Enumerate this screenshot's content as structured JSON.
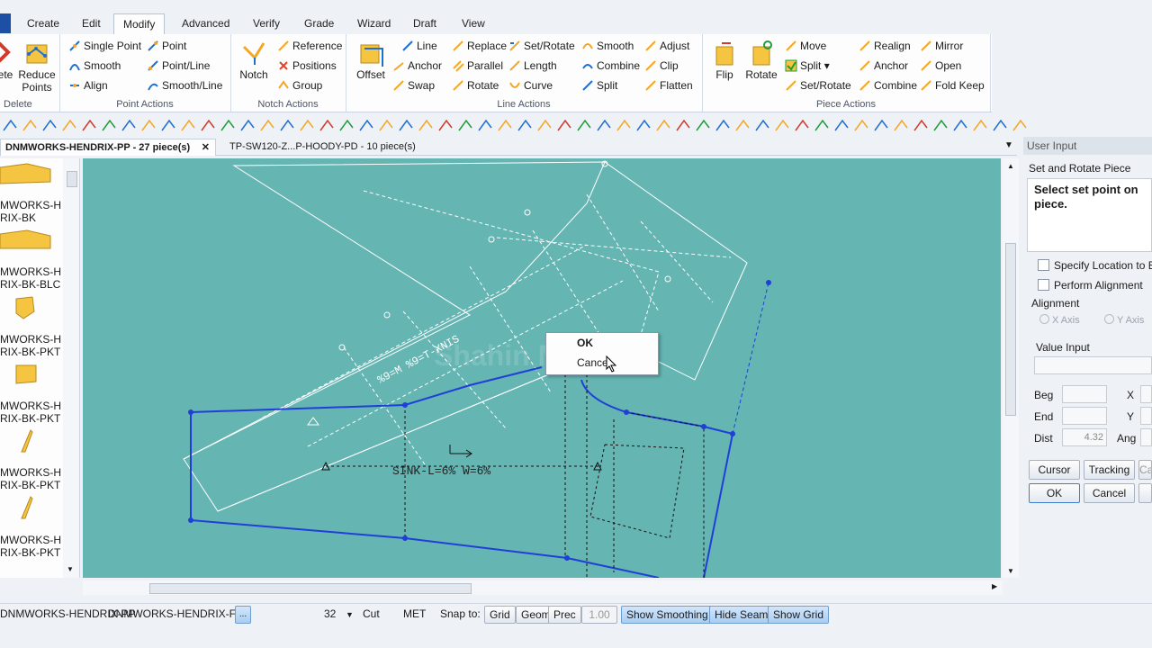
{
  "menu": {
    "tabs": [
      {
        "label": "Create"
      },
      {
        "label": "Edit"
      },
      {
        "label": "Modify"
      },
      {
        "label": "Advanced"
      },
      {
        "label": "Verify"
      },
      {
        "label": "Grade"
      },
      {
        "label": "Wizard"
      },
      {
        "label": "Draft"
      },
      {
        "label": "View"
      }
    ],
    "active": "Modify"
  },
  "ribbon": {
    "delete": {
      "label": "Delete",
      "left_btn": "ete",
      "reduce_points": "Reduce\nPoints"
    },
    "point_actions": {
      "label": "Point Actions",
      "items": [
        "Single Point",
        "Point",
        "Smooth",
        "Point/Line",
        "Align",
        "Smooth/Line"
      ]
    },
    "notch_actions": {
      "label": "Notch Actions",
      "notch": "Notch",
      "items": [
        "Reference",
        "Positions",
        "Group"
      ]
    },
    "line_actions": {
      "label": "Line Actions",
      "offset": "Offset",
      "items": [
        "Line",
        "Replace",
        "Set/Rotate",
        "Smooth",
        "Adjust",
        "Anchor",
        "Parallel",
        "Length",
        "Combine",
        "Clip",
        "Swap",
        "Rotate",
        "Curve",
        "Split",
        "Flatten"
      ]
    },
    "piece_actions": {
      "label": "Piece Actions",
      "flip": "Flip",
      "rotate": "Rotate",
      "items": [
        "Move",
        "Realign",
        "Mirror",
        "Split",
        "Anchor",
        "Open",
        "Set/Rotate",
        "Combine",
        "Fold Keep"
      ]
    }
  },
  "doc_tabs": [
    {
      "label": "DNMWORKS-HENDRIX-PP  -  27 piece(s)",
      "close": "✕"
    },
    {
      "label": "TP-SW120-Z...P-HOODY-PD  -  10 piece(s)"
    }
  ],
  "pieces": [
    "MWORKS-H",
    "RIX-BK",
    "MWORKS-H",
    "RIX-BK-BLC",
    "MWORKS-H",
    "RIX-BK-PKT",
    "MWORKS-H",
    "RIX-BK-PKT",
    "MWORKS-H",
    "RIX-BK-PKT",
    "MWORKS-H",
    "RIX-BK-PKT"
  ],
  "canvas": {
    "annotation": "SINK-L=6% W=6%",
    "rotated_annotation": "%9=M %9=T-XNIS",
    "watermark": "Shahin Mondol"
  },
  "context_menu": {
    "ok": "OK",
    "cancel": "Cancel"
  },
  "user_input": {
    "header": "User Input",
    "title": "Set and Rotate Piece",
    "prompt": "Select set point on piece.",
    "specify_location": "Specify Location to Bump",
    "perform_alignment": "Perform Alignment",
    "alignment": "Alignment",
    "x_axis": "X Axis",
    "y_axis": "Y Axis",
    "value_input": "Value Input",
    "beg": "Beg",
    "end": "End",
    "dist": "Dist",
    "dist_value": "4.32",
    "x": "X",
    "y": "Y",
    "ang": "Ang",
    "cursor": "Cursor",
    "tracking": "Tracking",
    "cut": "Ca",
    "ok": "OK",
    "cancel": "Cancel"
  },
  "status": {
    "doc1": "DNMWORKS-HENDRIX-PP",
    "doc2": "DNMWORKS-HENDRIX-FR",
    "more": "...",
    "zoom": "32",
    "cut": "Cut",
    "units": "MET",
    "snap_to": "Snap to:",
    "grid": "Grid",
    "geom": "Geom",
    "prec": "Prec",
    "prec_value": "1.00",
    "show_smoothing": "Show Smoothing",
    "hide_seams": "Hide Seams",
    "show_grid": "Show Grid"
  },
  "colors": {
    "canvas": "#65b5b3",
    "selected_piece": "#1f3fd6",
    "piece_outline": "#ffffff",
    "menu_blue": "#1d4fa5"
  }
}
